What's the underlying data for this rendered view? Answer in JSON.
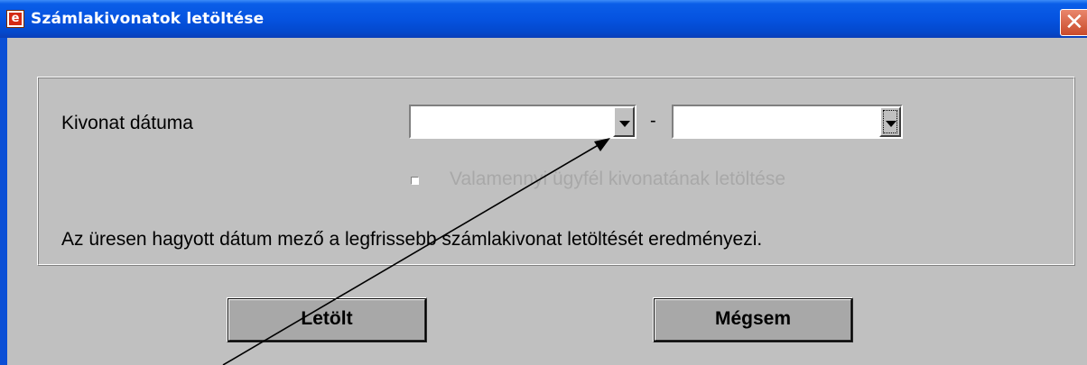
{
  "window": {
    "title": "Számlakivonatok letöltése",
    "app_icon_glyph": "e",
    "close_glyph": "✕"
  },
  "form": {
    "date_label": "Kivonat dátuma",
    "date_from_value": "",
    "date_to_value": "",
    "range_separator": "-",
    "all_clients_label": "Valamennyi ügyfél kivonatának letöltése",
    "all_clients_checked": false,
    "all_clients_enabled": false,
    "info_text": "Az üresen hagyott dátum mező a legfrissebb számlakivonat letöltését eredményezi."
  },
  "buttons": {
    "download_label": "Letölt",
    "cancel_label": "Mégsem"
  },
  "annotation": {
    "type": "arrow",
    "target": "date-from-dropdown-button",
    "color": "#000000"
  },
  "colors": {
    "titlebar": "#0553e0",
    "dialog_bg": "#c0c0c0",
    "button_face": "#a8a8a8",
    "close_button": "#c94a2a",
    "disabled_text": "#a8a8a8"
  }
}
